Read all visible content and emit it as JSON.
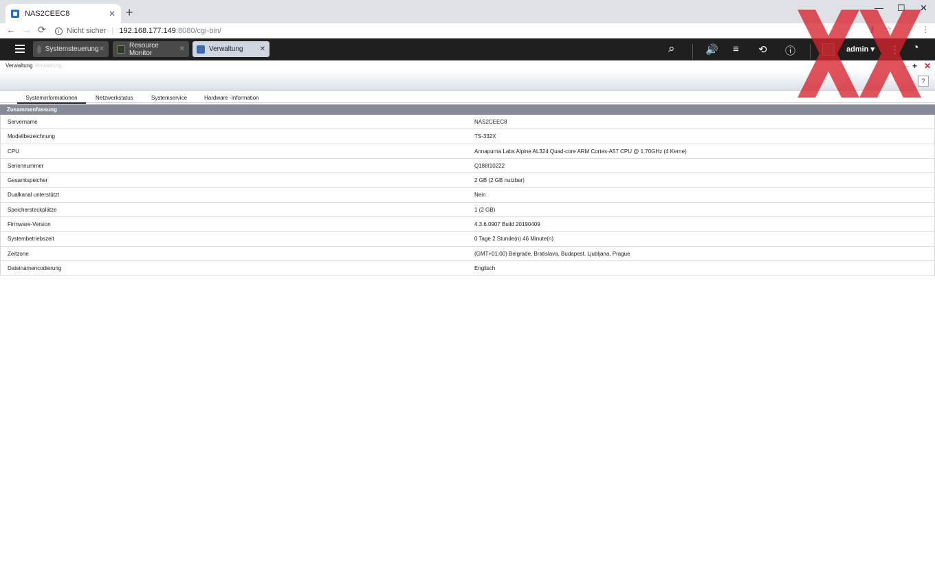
{
  "browser": {
    "tab_title": "NAS2CEEC8",
    "tab_close": "✕",
    "new_tab": "+",
    "window_controls": {
      "minimize": "—",
      "maximize": "☐",
      "close": "✕"
    },
    "back": "←",
    "forward": "→",
    "reload": "⟳",
    "security_text": "Nicht sicher",
    "url_host": "192.168.177.149",
    "url_rest": ":8080/cgi-bin/",
    "key_glyph": "⚷",
    "star_glyph": "☆",
    "menu_glyph": "⋮"
  },
  "toolbar": {
    "apps": [
      {
        "label": "Systemsteuerung",
        "close": "✕"
      },
      {
        "label": "Resource Monitor",
        "close": "✕"
      },
      {
        "label": "Verwaltung",
        "close": "✕"
      }
    ],
    "search_glyph": "⌕",
    "volume_glyph": "🔊",
    "tasks_glyph": "≡",
    "sync_glyph": "⟲",
    "info_glyph": "ⓘ",
    "user": "admin ▾",
    "more_glyph": "⋮",
    "dashboard_glyph": "◔"
  },
  "window": {
    "title": "Verwaltung",
    "subtitle": "Verwaltung",
    "minimize": "—",
    "add": "+",
    "close": "✕",
    "help": "?"
  },
  "tabs": [
    "Systeminformationen",
    "Netzwerkstatus",
    "Systemservice",
    "Hardware -Information"
  ],
  "section_title": "Zusammenfassung",
  "rows": [
    {
      "key": "Servername",
      "value": "NAS2CEEC8"
    },
    {
      "key": "Modellbezeichnung",
      "value": "TS-332X"
    },
    {
      "key": "CPU",
      "value": "Annapurna Labs Alpine AL324 Quad-core ARM Cortex-A57 CPU @ 1.70GHz (4 Kerne)"
    },
    {
      "key": "Seriennummer",
      "value": "Q188I10222"
    },
    {
      "key": "Gesamtspeicher",
      "value": "2 GB (2 GB nutzbar)"
    },
    {
      "key": "Dualkanal unterstützt",
      "value": "Nein"
    },
    {
      "key": "Speichersteckplätze",
      "value": "1 (2 GB)"
    },
    {
      "key": "Firmware-Version",
      "value": "4.3.6.0907 Build 20190409"
    },
    {
      "key": "Systembetriebszeit",
      "value": "0 Tage 2 Stunde(n) 46 Minute(n)"
    },
    {
      "key": "Zeitzone",
      "value": "(GMT+01:00) Belgrade, Bratislava, Budapest, Ljubljana, Prague"
    },
    {
      "key": "Dateinamencodierung",
      "value": "Englisch"
    }
  ],
  "colors": {
    "accent_red": "#d9232e",
    "toolbar_bg": "#1f1f1f",
    "section_bg": "#858c97"
  }
}
